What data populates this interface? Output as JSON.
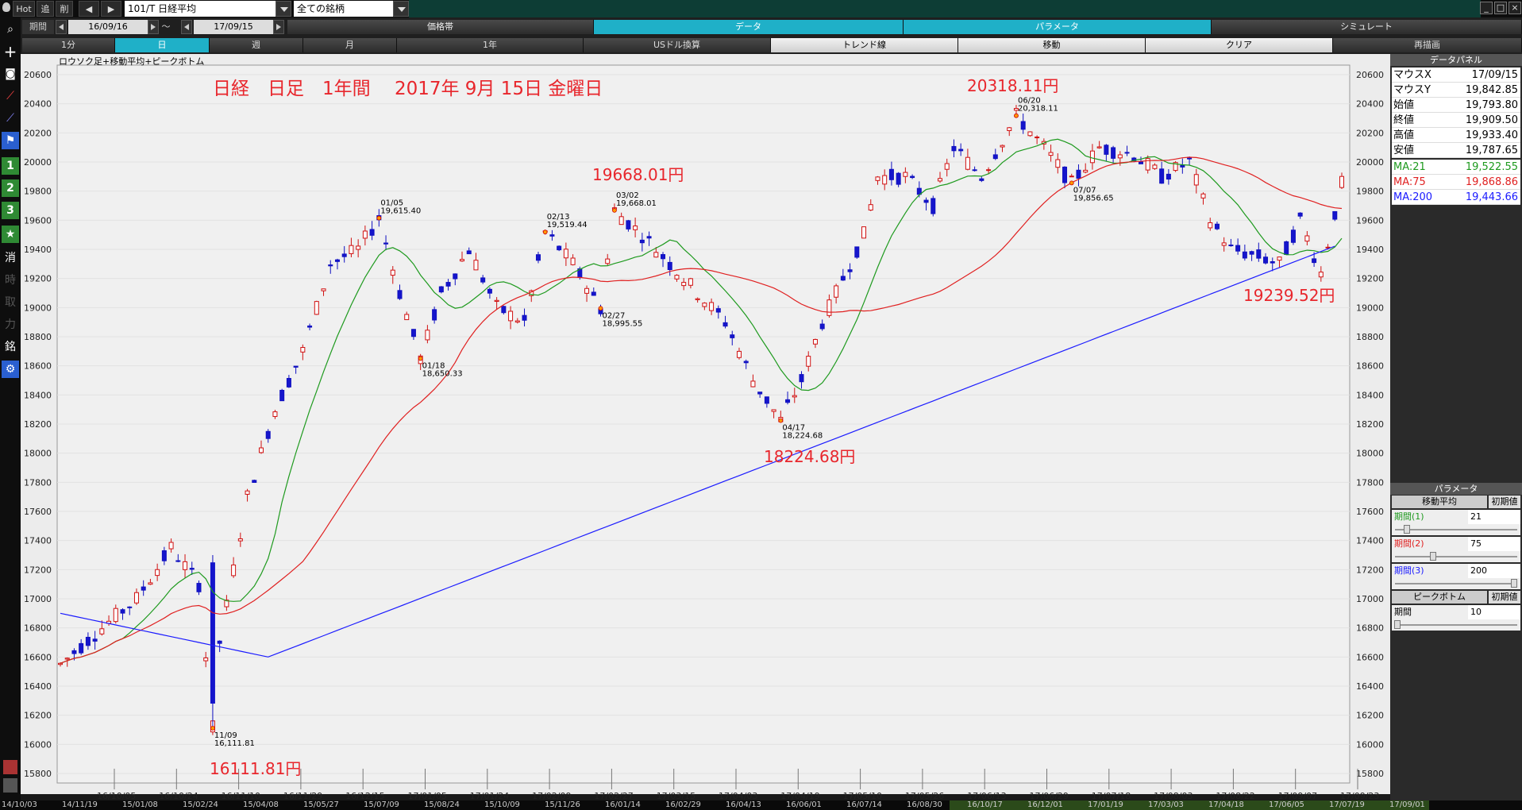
{
  "topbar": {
    "hot": "Hot",
    "tsui": "追",
    "sakujo": "削",
    "symbol": "101/T 日経平均",
    "universe": "全ての銘柄"
  },
  "row2": {
    "kikan": "期間",
    "from": "16/09/16",
    "tilde": "～",
    "to": "17/09/15",
    "seg_kakakutai": "価格帯",
    "seg_data": "データ",
    "seg_param": "パラメータ",
    "seg_simulate": "シミュレート"
  },
  "row3": {
    "b_1min": "1分",
    "b_day": "日",
    "b_week": "週",
    "b_month": "月",
    "b_year": "1年",
    "b_usd": "USドル換算",
    "b_trend": "トレンド線",
    "b_move": "移動",
    "b_clear": "クリア",
    "b_redraw": "再描画"
  },
  "lefttb": [
    "search-icon",
    "plus-icon",
    "camera-icon",
    "chart-red-icon",
    "chart-blue-icon",
    "flag-icon",
    "1",
    "2",
    "3",
    "★",
    "消",
    "時",
    "取",
    "力",
    "銘",
    "gear-icon"
  ],
  "chart": {
    "indicator": "ロウソク足+移動平均+ピークボトム",
    "title": "日経　日足　1年間　 2017年 9月 15日 金曜日",
    "peaks_big": [
      {
        "text": "20318.11円"
      },
      {
        "text": "19668.01円"
      },
      {
        "text": "18224.68円"
      },
      {
        "text": "19239.52円"
      },
      {
        "text": "16111.81円"
      }
    ]
  },
  "chart_data": {
    "type": "candlestick",
    "ylim": [
      15800,
      20600
    ],
    "yticks": [
      15800,
      16000,
      16200,
      16400,
      16600,
      16800,
      17000,
      17200,
      17400,
      17600,
      17800,
      18000,
      18200,
      18400,
      18600,
      18800,
      19000,
      19200,
      19400,
      19600,
      19800,
      20000,
      20200,
      20400,
      20600
    ],
    "xticks": [
      "16/10/05",
      "16/10/24",
      "16/11/10",
      "16/11/29",
      "16/12/15",
      "17/01/05",
      "17/01/24",
      "17/02/09",
      "17/02/27",
      "17/03/15",
      "17/04/03",
      "17/04/19",
      "17/05/10",
      "17/05/26",
      "17/06/13",
      "17/06/29",
      "17/07/18",
      "17/08/03",
      "17/08/22",
      "17/09/07",
      "17/09/23"
    ],
    "peaks": [
      {
        "date": "01/05",
        "value": "19,615.40"
      },
      {
        "date": "01/18",
        "value": "18,650.33"
      },
      {
        "date": "02/13",
        "value": "19,519.44"
      },
      {
        "date": "02/27",
        "value": "18,995.55"
      },
      {
        "date": "03/02",
        "value": "19,668.01"
      },
      {
        "date": "04/17",
        "value": "18,224.68"
      },
      {
        "date": "06/20",
        "value": "20,318.11"
      },
      {
        "date": "07/07",
        "value": "19,856.65"
      },
      {
        "date": "11/09",
        "value": "16,111.81"
      }
    ],
    "series": [
      {
        "name": "MA:21",
        "color": "#1e9a1e"
      },
      {
        "name": "MA:75",
        "color": "#e02020"
      },
      {
        "name": "MA:200",
        "color": "#1a1aff"
      }
    ]
  },
  "datapanel": {
    "header": "データパネル",
    "rows": [
      {
        "k": "マウスX",
        "v": "17/09/15"
      },
      {
        "k": "マウスY",
        "v": "19,842.85"
      },
      {
        "k": "始値",
        "v": "19,793.80"
      },
      {
        "k": "終値",
        "v": "19,909.50"
      },
      {
        "k": "高値",
        "v": "19,933.40"
      },
      {
        "k": "安値",
        "v": "19,787.65"
      },
      {
        "k": "MA:21",
        "v": "19,522.55"
      },
      {
        "k": "MA:75",
        "v": "19,868.86"
      },
      {
        "k": "MA:200",
        "v": "19,443.66"
      }
    ]
  },
  "params": {
    "header": "パラメータ",
    "ma_title": "移動平均",
    "init": "初期値",
    "p1_label": "期間(1)",
    "p1_value": "21",
    "p1_level": 0.1,
    "p2_label": "期間(2)",
    "p2_value": "75",
    "p2_level": 0.32,
    "p3_label": "期間(3)",
    "p3_value": "200",
    "p3_level": 1.0,
    "pb_title": "ピークボトム",
    "pb_label": "期間",
    "pb_value": "10",
    "pb_level": 0.02
  },
  "bottomnav": [
    "14/10/03",
    "14/11/19",
    "15/01/08",
    "15/02/24",
    "15/04/08",
    "15/05/27",
    "15/07/09",
    "15/08/24",
    "15/10/09",
    "15/11/26",
    "16/01/14",
    "16/02/29",
    "16/04/13",
    "16/06/01",
    "16/07/14",
    "16/08/30",
    "16/10/17",
    "16/12/01",
    "17/01/19",
    "17/03/03",
    "17/04/18",
    "17/06/05",
    "17/07/19",
    "17/09/01"
  ]
}
